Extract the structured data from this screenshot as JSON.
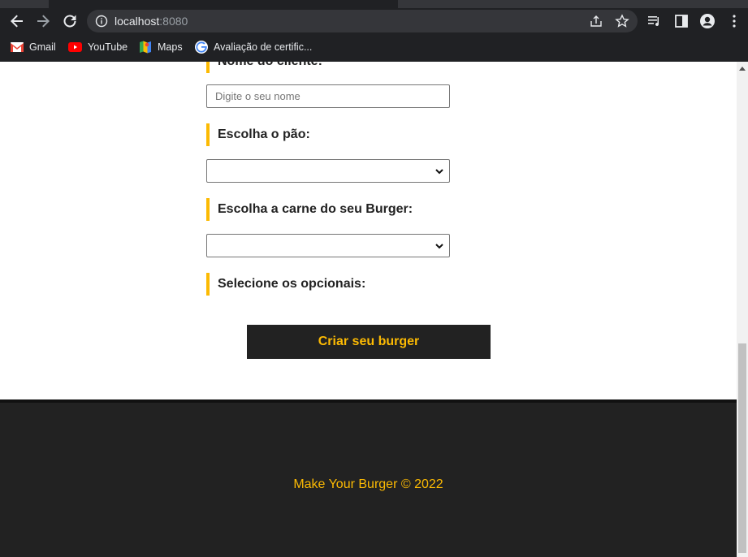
{
  "browser": {
    "url_host": "localhost",
    "url_port": ":8080",
    "bookmarks": [
      {
        "label": "Gmail",
        "icon": "gmail-icon"
      },
      {
        "label": "YouTube",
        "icon": "youtube-icon"
      },
      {
        "label": "Maps",
        "icon": "maps-icon"
      },
      {
        "label": "Avaliação de certific...",
        "icon": "google-icon"
      }
    ]
  },
  "form": {
    "name_label": "Nome do cliente:",
    "name_placeholder": "Digite o seu nome",
    "name_value": "",
    "bread_label": "Escolha o pão:",
    "bread_value": "",
    "meat_label": "Escolha a carne do seu Burger:",
    "meat_value": "",
    "options_label": "Selecione os opcionais:",
    "submit_label": "Criar seu burger"
  },
  "footer": {
    "text": "Make Your Burger © 2022"
  },
  "colors": {
    "accent": "#fcba03",
    "dark": "#222222"
  }
}
